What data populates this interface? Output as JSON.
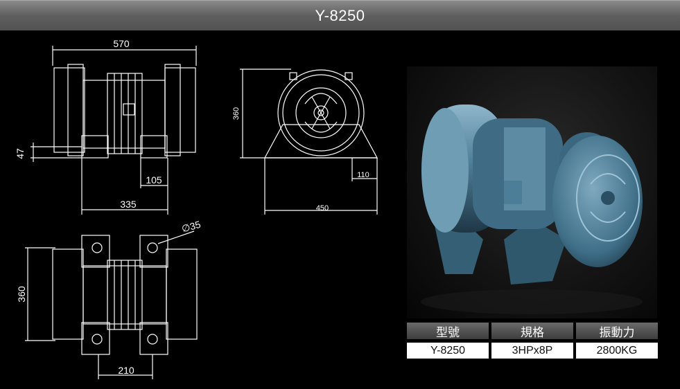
{
  "header": {
    "title": "Y-8250"
  },
  "dimensions": {
    "top_width": "570",
    "left_offset": "47",
    "inner_a": "105",
    "inner_b": "335",
    "front_height": "360",
    "front_foot": "110",
    "front_width": "450",
    "hole_dia": "∅35",
    "bottom_height": "360",
    "bottom_spacing": "210"
  },
  "spec_table": {
    "headers": [
      "型號",
      "規格",
      "振動力"
    ],
    "values": [
      "Y-8250",
      "3HPx8P",
      "2800KG"
    ]
  },
  "colors": {
    "accent": "#5b8aa4",
    "line": "#ffffff"
  }
}
